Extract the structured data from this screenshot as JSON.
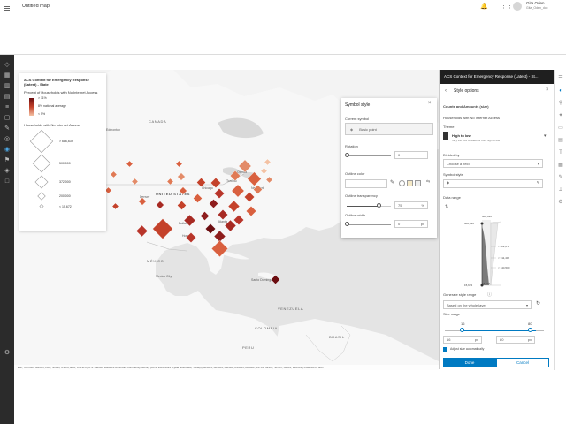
{
  "app": {
    "title": "Untitled map"
  },
  "user": {
    "name": "Gita Oden",
    "username": "Gita_Oden_doc"
  },
  "legend": {
    "layer_title": "ACS Context for Emergency Response (Latest) - State",
    "color_field": "Percent of Households with No Internet Access",
    "color_high": "> 11%",
    "color_mid": "8%  national average",
    "color_low": "< 5%",
    "size_field": "Households with No Internet Access",
    "size_values": [
      "> 686,639",
      "500,000",
      "372,000",
      "200,000",
      "< 15,672"
    ]
  },
  "symbol_style": {
    "title": "Symbol style",
    "current_symbol_label": "Current symbol",
    "current_symbol_value": "Basic point",
    "rotation_label": "Rotation",
    "rotation_value": "0",
    "outline_color_label": "Outline color",
    "outline_transparency_label": "Outline transparency",
    "outline_transparency_value": "75",
    "outline_transparency_unit": "%",
    "outline_width_label": "Outline width",
    "outline_width_value": "0",
    "outline_width_unit": "px"
  },
  "right_panel": {
    "header": "ACS Context for Emergency Response (Latest) - St...",
    "sub_title": "Style options",
    "section": "Counts and Amounts (size)",
    "field": "Households with No Internet Access",
    "theme_label": "Theme",
    "theme_value": "High to low",
    "theme_desc": "Vary the size of features from high to low",
    "divided_by_label": "Divided by",
    "divided_by_value": "Choose a field",
    "symbol_style_label": "Symbol style",
    "data_range_label": "Data range",
    "hist_max": "686,639",
    "hist_upper": "686,639",
    "hist_tick1": "< 422,0.0",
    "hist_tick2": "< 311,403",
    "hist_tick3": "< 144,500",
    "hist_lower": "15,672",
    "hist_min": "15,672",
    "generate_label": "Generate style range",
    "generate_value": "Based on the whole layer",
    "size_range_label": "Size range",
    "size_min": "16",
    "size_max": "80",
    "size_unit": "px",
    "adjust_label": "Adjust size automatically",
    "done_label": "Done",
    "cancel_label": "Cancel"
  },
  "map": {
    "labels": [
      "CANADA",
      "Edmonton",
      "UNITED STATES",
      "MÉXICO",
      "Mexico City",
      "Santo Domingo",
      "VENEZUELA",
      "COLOMBIA",
      "PERU",
      "BRASIL",
      "Ottawa",
      "Toronto",
      "New York",
      "Chicago",
      "Denver",
      "Atlanta",
      "Dallas",
      "Houston"
    ],
    "attribution": "Esri, TomTom, Garmin, FAO, NOAA, USGS, EPA, USFWS | U.S. Census Bureau's American Community Survey (ACS) 2020-2024 5-year Estimates, Table(s) B01001, B01003, B11001, B19013, B25002, S1701, S2301, S2701, S2801, B18101 | Powered by Esri"
  },
  "colors": {
    "dark": "#6b0d10",
    "mid": "#c4422b",
    "light": "#f3c2a4",
    "accent": "#007ac2",
    "header": "#1f1f1f"
  },
  "chart_data": {
    "type": "histogram",
    "title": "Data range",
    "max": 686639,
    "min": 15672,
    "tick_labels": [
      "686,639",
      "< 422,0.0",
      "< 311,403",
      "< 144,500",
      "15,672"
    ]
  }
}
